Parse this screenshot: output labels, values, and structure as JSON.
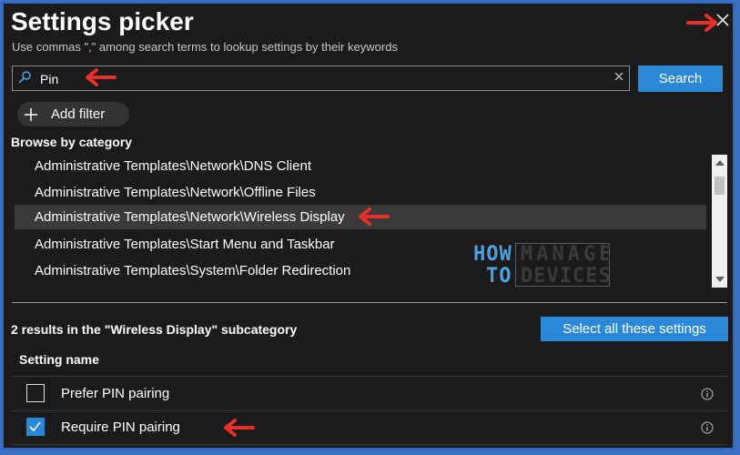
{
  "window": {
    "title": "Settings picker",
    "subtitle": "Use commas \",\" among search terms to lookup settings by their keywords"
  },
  "search": {
    "value": "Pin",
    "button_label": "Search"
  },
  "filter": {
    "add_label": "Add filter"
  },
  "browse": {
    "heading": "Browse by category",
    "items": [
      {
        "label": "Administrative Templates\\Network\\DNS Client",
        "selected": false
      },
      {
        "label": "Administrative Templates\\Network\\Offline Files",
        "selected": false
      },
      {
        "label": "Administrative Templates\\Network\\Wireless Display",
        "selected": true
      },
      {
        "label": "Administrative Templates\\Start Menu and Taskbar",
        "selected": false
      },
      {
        "label": "Administrative Templates\\System\\Folder Redirection",
        "selected": false
      }
    ]
  },
  "results": {
    "summary": "2 results in the \"Wireless Display\" subcategory",
    "select_all_label": "Select all these settings",
    "column_header": "Setting name",
    "rows": [
      {
        "label": "Prefer PIN pairing",
        "checked": false
      },
      {
        "label": "Require PIN pairing",
        "checked": true
      }
    ]
  },
  "watermark": {
    "line1_left": "HOW",
    "line2_left": "TO",
    "line1_right": "MANAGE",
    "line2_right": "DEVICES"
  },
  "colors": {
    "accent": "#2b88d8",
    "annotation_arrow": "#e8302a",
    "background": "#1b1b1b"
  },
  "icons": [
    "close-icon",
    "search-icon",
    "clear-icon",
    "plus-icon",
    "info-icon",
    "checkmark-icon",
    "annotation-arrow-icon"
  ]
}
